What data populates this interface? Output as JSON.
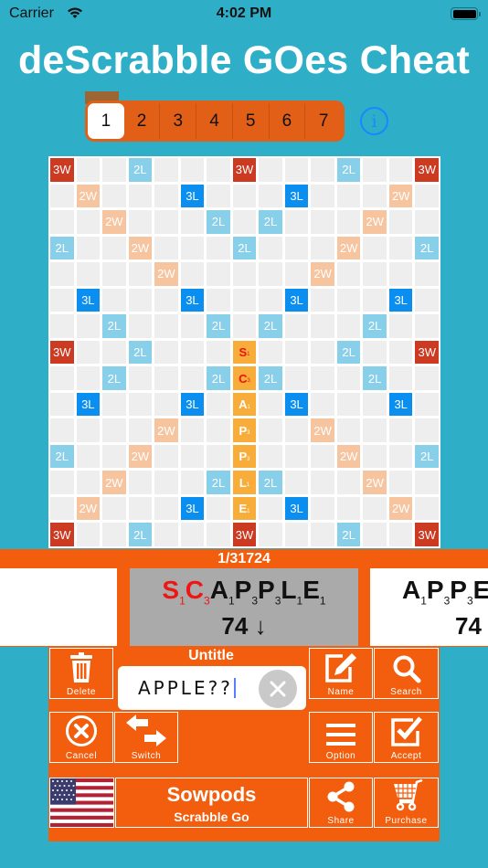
{
  "status_bar": {
    "carrier": "Carrier",
    "time": "4:02 PM"
  },
  "app_title": "deScrabble GOes Cheat",
  "pages": {
    "items": [
      "1",
      "2",
      "3",
      "4",
      "5",
      "6",
      "7"
    ],
    "selected": "1"
  },
  "colors": {
    "background": "#2eafc7",
    "accent": "#f25e0d",
    "triple_word": "#cc3a22",
    "double_word": "#f7c4a0",
    "triple_letter": "#0a8ff0",
    "double_letter": "#88cfea",
    "tile": "#f8ad3a",
    "blank_letter": "#e8130f"
  },
  "board": {
    "premium_labels": {
      "tw": "3W",
      "dw": "2W",
      "tl": "3L",
      "dl": "2L"
    },
    "rows": [
      "T..d...T...d..T",
      ".D...t...t...D.",
      "..D...d.d...D..",
      "d..D...d...D..d",
      "....D.....D....",
      ".t...t...t...t.",
      "..d...d.d...d..",
      "T..d...#...d..T",
      "..d...d#d...d..",
      ".t...t.#.t...t.",
      "....D..#..D....",
      "d..D...#...D..d",
      "..D...d#d...D..",
      ".D...t.#.t...D.",
      "T..d...T...d..T"
    ],
    "tiles": [
      {
        "row": 7,
        "col": 7,
        "letter": "S",
        "points": "1",
        "blank": true
      },
      {
        "row": 8,
        "col": 7,
        "letter": "C",
        "points": "3",
        "blank": true
      },
      {
        "row": 9,
        "col": 7,
        "letter": "A",
        "points": "1",
        "blank": false
      },
      {
        "row": 10,
        "col": 7,
        "letter": "P",
        "points": "3",
        "blank": false
      },
      {
        "row": 11,
        "col": 7,
        "letter": "P",
        "points": "3",
        "blank": false
      },
      {
        "row": 12,
        "col": 7,
        "letter": "L",
        "points": "1",
        "blank": false
      },
      {
        "row": 13,
        "col": 7,
        "letter": "E",
        "points": "1",
        "blank": false
      }
    ]
  },
  "results": {
    "counter": "1/31724",
    "current": {
      "letters": [
        {
          "l": "S",
          "p": "1",
          "blank": true
        },
        {
          "l": "C",
          "p": "3",
          "blank": true
        },
        {
          "l": "A",
          "p": "1",
          "blank": false
        },
        {
          "l": "P",
          "p": "3",
          "blank": false
        },
        {
          "l": "P",
          "p": "3",
          "blank": false
        },
        {
          "l": "L",
          "p": "1",
          "blank": false
        },
        {
          "l": "E",
          "p": "1",
          "blank": false
        }
      ],
      "score": "74",
      "direction_arrow": "↓"
    },
    "next": {
      "letters": [
        {
          "l": "A",
          "p": "1",
          "blank": false
        },
        {
          "l": "P",
          "p": "3",
          "blank": false
        },
        {
          "l": "P",
          "p": "3",
          "blank": false
        },
        {
          "l": "E",
          "p": "",
          "blank": false
        }
      ],
      "score": "74"
    }
  },
  "controls": {
    "title": "Untitle",
    "rack_input_value": "APPLE??",
    "buttons": {
      "delete": "Delete",
      "cancel": "Cancel",
      "switch": "Switch",
      "name": "Name",
      "search": "Search",
      "option": "Option",
      "accept": "Accept",
      "share": "Share",
      "purchase": "Purchase"
    },
    "dictionary": {
      "name": "Sowpods",
      "game": "Scrabble Go"
    },
    "language_flag": "us-flag"
  }
}
